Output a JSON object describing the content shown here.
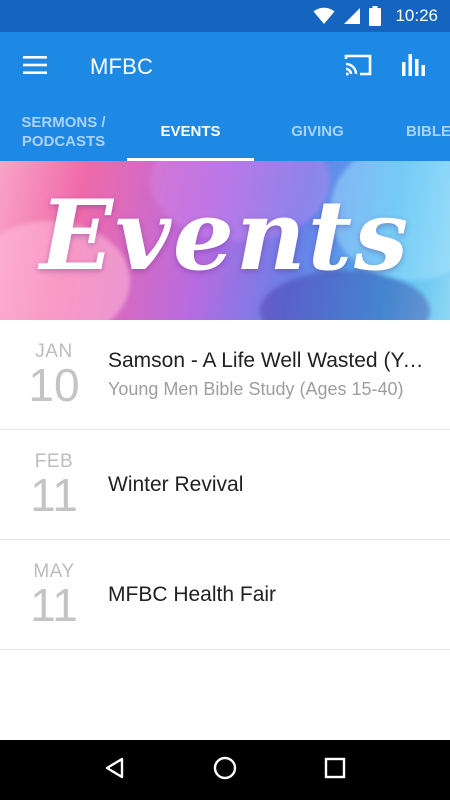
{
  "status_bar": {
    "time": "10:26",
    "icons": [
      "wifi-icon",
      "signal-icon",
      "battery-icon"
    ]
  },
  "app_bar": {
    "title": "MFBC",
    "icons": [
      "menu-icon",
      "cast-icon",
      "bar-chart-icon"
    ]
  },
  "tabs": [
    {
      "label": "SERMONS /\nPODCASTS",
      "active": false
    },
    {
      "label": "EVENTS",
      "active": true
    },
    {
      "label": "GIVING",
      "active": false
    },
    {
      "label": "BIBLE",
      "active": false
    }
  ],
  "banner": {
    "text": "Events"
  },
  "events": [
    {
      "month": "JAN",
      "day": "10",
      "title": "Samson - A Life Well Wasted (Young Men Bible Study)",
      "subtitle": "Young Men Bible Study (Ages 15-40)"
    },
    {
      "month": "FEB",
      "day": "11",
      "title": "Winter Revival",
      "subtitle": ""
    },
    {
      "month": "MAY",
      "day": "11",
      "title": "MFBC Health Fair",
      "subtitle": ""
    }
  ],
  "nav_bar": {
    "icons": [
      "back-icon",
      "home-icon",
      "recents-icon"
    ]
  },
  "colors": {
    "status_bar": "#1565c0",
    "primary": "#1e88e5",
    "date_text": "#bdbdbd",
    "title_text": "#212121",
    "subtitle_text": "#9e9e9e"
  }
}
